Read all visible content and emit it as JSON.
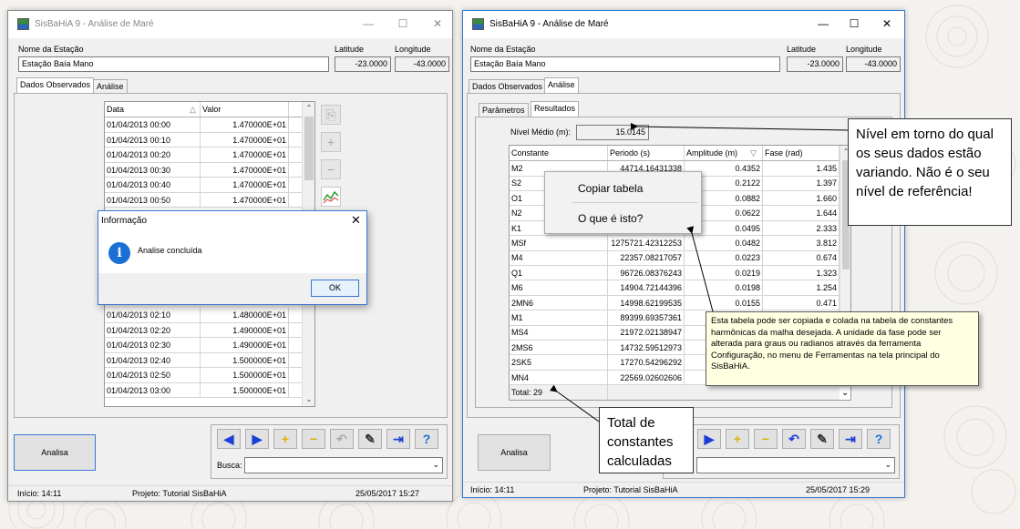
{
  "left_window": {
    "title": "SisBaHiA 9 - Análise de Maré",
    "station_name_label": "Nome da Estação",
    "station_name": "Estação Baía Mano",
    "latitude_label": "Latitude",
    "latitude": "-23.0000",
    "longitude_label": "Longitude",
    "longitude": "-43.0000",
    "tabs": [
      {
        "label": "Dados Observados"
      },
      {
        "label": "Análise"
      }
    ],
    "table": {
      "headers": [
        "Data",
        "Valor"
      ],
      "rows_top": [
        {
          "date": "01/04/2013 00:00",
          "value": "1.470000E+01"
        },
        {
          "date": "01/04/2013 00:10",
          "value": "1.470000E+01"
        },
        {
          "date": "01/04/2013 00:20",
          "value": "1.470000E+01"
        },
        {
          "date": "01/04/2013 00:30",
          "value": "1.470000E+01"
        },
        {
          "date": "01/04/2013 00:40",
          "value": "1.470000E+01"
        },
        {
          "date": "01/04/2013 00:50",
          "value": "1.470000E+01"
        }
      ],
      "rows_bottom": [
        {
          "date": "01/04/2013 02:10",
          "value": "1.480000E+01"
        },
        {
          "date": "01/04/2013 02:20",
          "value": "1.490000E+01"
        },
        {
          "date": "01/04/2013 02:30",
          "value": "1.490000E+01"
        },
        {
          "date": "01/04/2013 02:40",
          "value": "1.500000E+01"
        },
        {
          "date": "01/04/2013 02:50",
          "value": "1.500000E+01"
        },
        {
          "date": "01/04/2013 03:00",
          "value": "1.500000E+01"
        }
      ]
    },
    "analyze_button": "Analisa",
    "search_label": "Busca:",
    "status": {
      "start": "Início: 14:11",
      "project": "Projeto: Tutorial SisBaHiA",
      "datetime": "25/05/2017 15:27"
    },
    "dialog": {
      "title": "Informação",
      "message": "Analise concluída",
      "ok": "OK"
    }
  },
  "right_window": {
    "title": "SisBaHiA 9 - Análise de Maré",
    "station_name_label": "Nome da Estação",
    "station_name": "Estação Baía Mano",
    "latitude_label": "Latitude",
    "latitude": "-23.0000",
    "longitude_label": "Longitude",
    "longitude": "-43.0000",
    "tabs": [
      {
        "label": "Dados Observados"
      },
      {
        "label": "Análise"
      }
    ],
    "subtabs": [
      {
        "label": "Parâmetros"
      },
      {
        "label": "Resultados"
      }
    ],
    "mean_level_label": "Nível Médio (m):",
    "mean_level": "15.0145",
    "table": {
      "headers": [
        "Constante",
        "Periodo (s)",
        "Amplitude (m)",
        "Fase (rad)"
      ],
      "rows": [
        {
          "name": "M2",
          "period": "44714.16431338",
          "amp": "0.4352",
          "phase": "1.435"
        },
        {
          "name": "S2",
          "period": "",
          "amp": "0.2122",
          "phase": "1.397"
        },
        {
          "name": "O1",
          "period": "",
          "amp": "0.0882",
          "phase": "1.660"
        },
        {
          "name": "N2",
          "period": "",
          "amp": "0.0622",
          "phase": "1.644"
        },
        {
          "name": "K1",
          "period": "",
          "amp": "0.0495",
          "phase": "2.333"
        },
        {
          "name": "MSf",
          "period": "1275721.42312253",
          "amp": "0.0482",
          "phase": "3.812"
        },
        {
          "name": "M4",
          "period": "22357.08217057",
          "amp": "0.0223",
          "phase": "0.674"
        },
        {
          "name": "Q1",
          "period": "96726.08376243",
          "amp": "0.0219",
          "phase": "1.323"
        },
        {
          "name": "M6",
          "period": "14904.72144396",
          "amp": "0.0198",
          "phase": "1.254"
        },
        {
          "name": "2MN6",
          "period": "14998.62199535",
          "amp": "0.0155",
          "phase": "0.471"
        },
        {
          "name": "M1",
          "period": "89399.69357361",
          "amp": "0.0111",
          "phase": "3.479"
        },
        {
          "name": "MS4",
          "period": "21972.02138947",
          "amp": "",
          "phase": ""
        },
        {
          "name": "2MS6",
          "period": "14732.59512973",
          "amp": "",
          "phase": ""
        },
        {
          "name": "2SK5",
          "period": "17270.54296292",
          "amp": "",
          "phase": ""
        },
        {
          "name": "MN4",
          "period": "22569.02602606",
          "amp": "",
          "phase": ""
        },
        {
          "name": "2Q1",
          "period": "100822.40076133",
          "amp": "",
          "phase": ""
        }
      ],
      "total": "Total: 29"
    },
    "context_menu": {
      "copy": "Copiar tabela",
      "what": "O que é isto?"
    },
    "tooltip": "Esta tabela pode ser copiada e colada na tabela de constantes harmônicas da malha desejada. A unidade da fase pode ser alterada para graus ou radianos através da ferramenta Configuração, no menu de Ferramentas na tela principal do SisBaHiA.",
    "analyze_button": "Analisa",
    "status": {
      "start": "Início: 14:11",
      "project": "Projeto: Tutorial SisBaHiA",
      "datetime": "25/05/2017 15:29"
    }
  },
  "callouts": {
    "level": "Nível em torno do qual os seus dados estão variando. Não é o seu nível de referência!",
    "total": "Total de constantes calculadas"
  },
  "colors": {
    "accent": "#2b79d0",
    "info_icon": "#1a6fd6",
    "tooltip_bg": "#ffffe1",
    "nav_arrow": "#1a3fd6",
    "nav_plus": "#d9b400"
  }
}
